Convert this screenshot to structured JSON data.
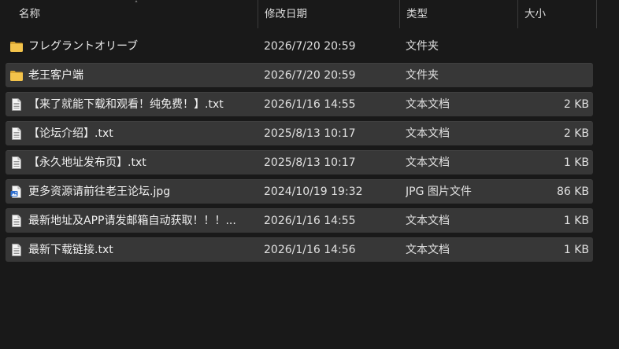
{
  "columns": {
    "name": "名称",
    "date": "修改日期",
    "type": "类型",
    "size": "大小"
  },
  "sort_indicator": "˄",
  "files": [
    {
      "icon": "folder-icon",
      "name": "フレグラントオリーブ",
      "date": "2026/7/20 20:59",
      "type": "文件夹",
      "size": "",
      "highlighted": false
    },
    {
      "icon": "folder-icon",
      "name": "老王客户端",
      "date": "2026/7/20 20:59",
      "type": "文件夹",
      "size": "",
      "highlighted": true
    },
    {
      "icon": "text-file-icon",
      "name": "【来了就能下载和观看！纯免费！】.txt",
      "date": "2026/1/16 14:55",
      "type": "文本文档",
      "size": "2 KB",
      "highlighted": true
    },
    {
      "icon": "text-file-icon",
      "name": "【论坛介绍】.txt",
      "date": "2025/8/13 10:17",
      "type": "文本文档",
      "size": "2 KB",
      "highlighted": true
    },
    {
      "icon": "text-file-icon",
      "name": "【永久地址发布页】.txt",
      "date": "2025/8/13 10:17",
      "type": "文本文档",
      "size": "1 KB",
      "highlighted": true
    },
    {
      "icon": "image-file-icon",
      "name": "更多资源请前往老王论坛.jpg",
      "date": "2024/10/19 19:32",
      "type": "JPG 图片文件",
      "size": "86 KB",
      "highlighted": true
    },
    {
      "icon": "text-file-icon",
      "name": "最新地址及APP请发邮箱自动获取！！！...",
      "date": "2026/1/16 14:55",
      "type": "文本文档",
      "size": "1 KB",
      "highlighted": true
    },
    {
      "icon": "text-file-icon",
      "name": "最新下载链接.txt",
      "date": "2026/1/16 14:56",
      "type": "文本文档",
      "size": "1 KB",
      "highlighted": true
    }
  ],
  "colors": {
    "background": "#191919",
    "row_highlight": "#373737",
    "folder": "#f3c34b",
    "text": "#f0f0f0"
  }
}
